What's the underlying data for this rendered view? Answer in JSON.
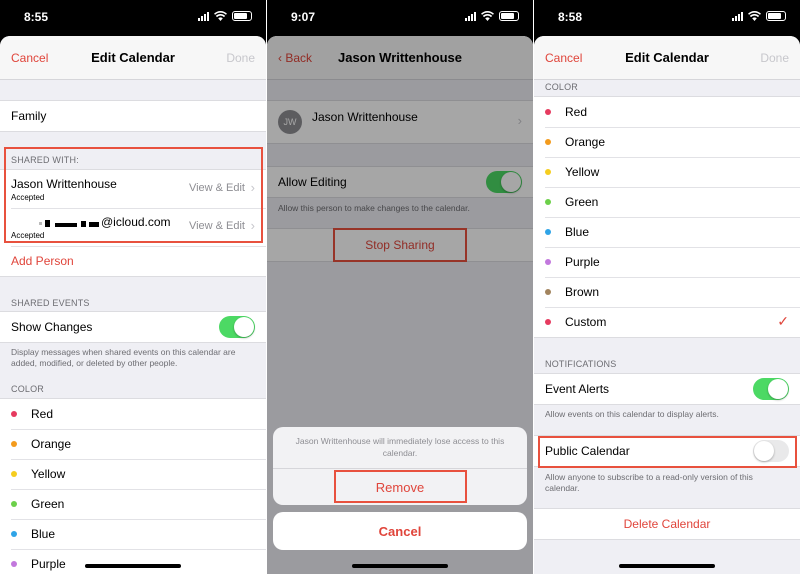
{
  "screens": {
    "edit_calendar_a": {
      "time": "8:55",
      "nav": {
        "cancel": "Cancel",
        "title": "Edit Calendar",
        "done": "Done"
      },
      "calendar_name": "Family",
      "shared_with": {
        "header": "SHARED WITH:",
        "people": [
          {
            "name": "Jason Writtenhouse",
            "status": "Accepted",
            "permission": "View & Edit"
          },
          {
            "name": "@icloud.com",
            "status": "Accepted",
            "permission": "View & Edit"
          }
        ],
        "add_person": "Add Person"
      },
      "shared_events": {
        "header": "SHARED EVENTS",
        "show_changes": "Show Changes",
        "show_changes_on": true,
        "footer": "Display messages when shared events on this calendar are added, modified, or deleted by other people."
      },
      "color": {
        "header": "COLOR",
        "items": [
          {
            "label": "Red",
            "color": "#e63a5f"
          },
          {
            "label": "Orange",
            "color": "#f39b1d"
          },
          {
            "label": "Yellow",
            "color": "#f5cd1f"
          },
          {
            "label": "Green",
            "color": "#6cd04a"
          },
          {
            "label": "Blue",
            "color": "#2fa4e7"
          },
          {
            "label": "Purple",
            "color": "#c278dd"
          }
        ]
      }
    },
    "person_detail": {
      "time": "9:07",
      "nav": {
        "back": "Back",
        "title": "Jason Writtenhouse"
      },
      "person": {
        "initials": "JW",
        "name": "Jason Writtenhouse"
      },
      "allow_editing": "Allow Editing",
      "allow_editing_on": true,
      "allow_editing_footer": "Allow this person to make changes to the calendar.",
      "stop_sharing": "Stop Sharing",
      "action_sheet": {
        "message": "Jason Writtenhouse will immediately lose access to this calendar.",
        "remove": "Remove",
        "cancel": "Cancel"
      }
    },
    "edit_calendar_b": {
      "time": "8:58",
      "nav": {
        "cancel": "Cancel",
        "title": "Edit Calendar",
        "done": "Done"
      },
      "color": {
        "header": "COLOR",
        "items": [
          {
            "label": "Red",
            "color": "#e63a5f"
          },
          {
            "label": "Orange",
            "color": "#f39b1d"
          },
          {
            "label": "Yellow",
            "color": "#f5cd1f"
          },
          {
            "label": "Green",
            "color": "#6cd04a"
          },
          {
            "label": "Blue",
            "color": "#2fa4e7"
          },
          {
            "label": "Purple",
            "color": "#c278dd"
          },
          {
            "label": "Brown",
            "color": "#a2845e"
          },
          {
            "label": "Custom",
            "color": "#e63a5f",
            "selected": true
          }
        ],
        "checkmark": "✓"
      },
      "notifications": {
        "header": "NOTIFICATIONS",
        "event_alerts": "Event Alerts",
        "event_alerts_on": true,
        "event_alerts_footer": "Allow events on this calendar to display alerts."
      },
      "public_calendar": {
        "label": "Public Calendar",
        "on": false,
        "footer": "Allow anyone to subscribe to a read-only version of this calendar."
      },
      "delete": "Delete Calendar"
    }
  },
  "accent_color": "#e0453b",
  "highlight_color": "#e8513e"
}
